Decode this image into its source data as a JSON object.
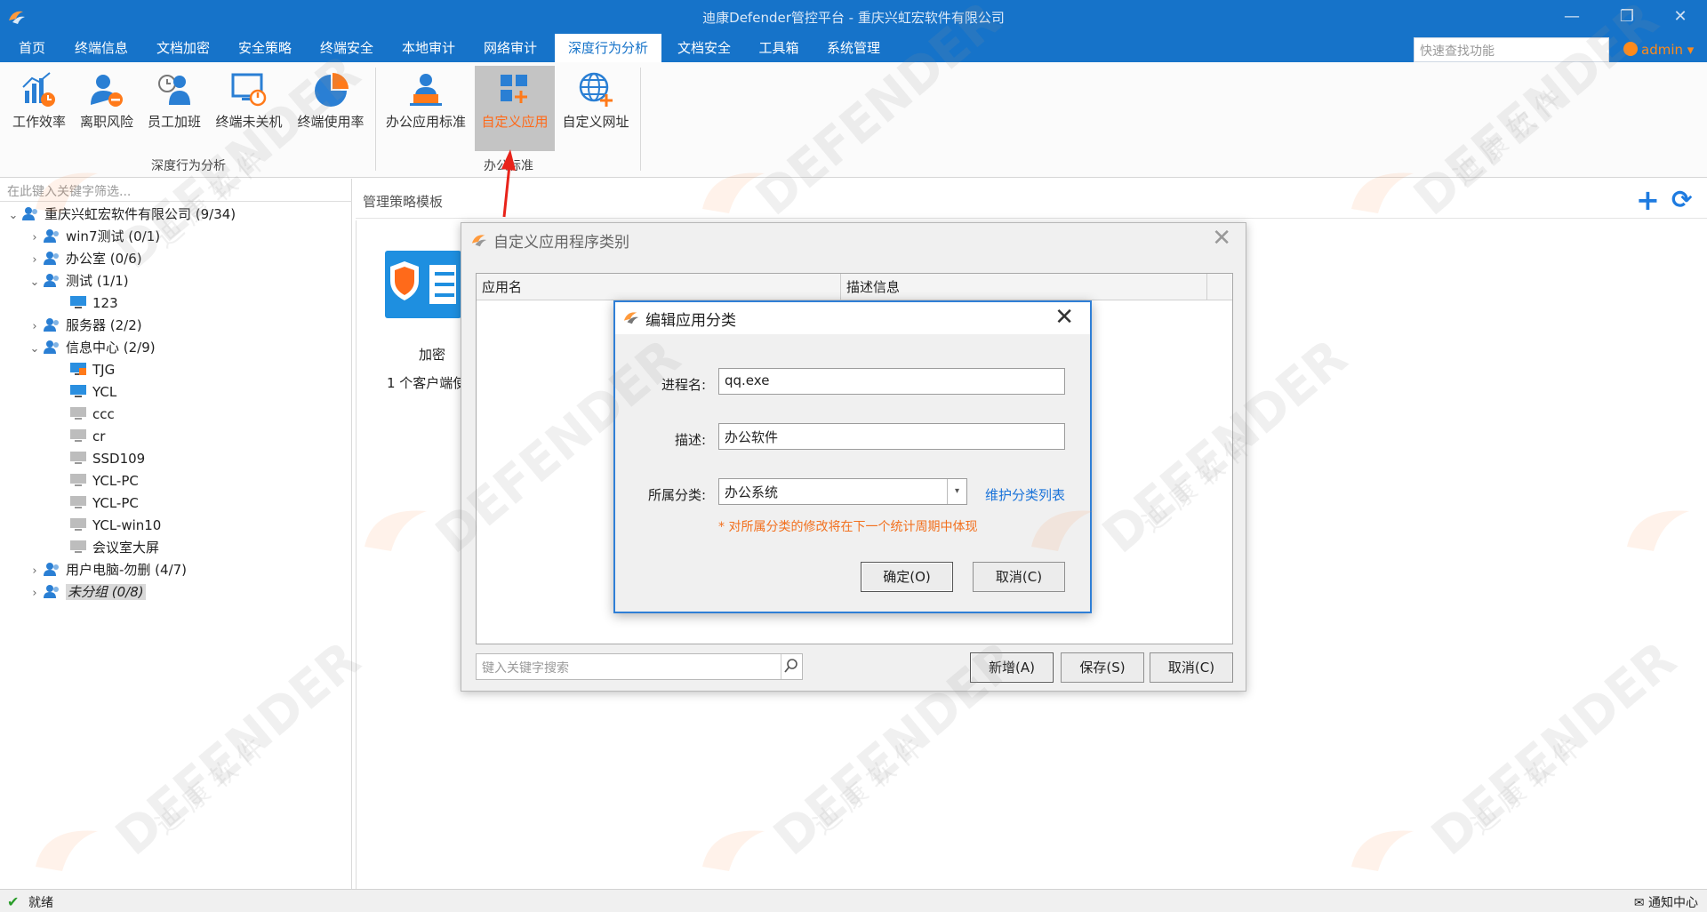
{
  "window": {
    "title": "迪康Defender管控平台 - 重庆兴虹宏软件有限公司",
    "min": "—",
    "restore": "❐",
    "close": "✕"
  },
  "menu": [
    {
      "label": "首页"
    },
    {
      "label": "终端信息"
    },
    {
      "label": "文档加密"
    },
    {
      "label": "安全策略"
    },
    {
      "label": "终端安全"
    },
    {
      "label": "本地审计"
    },
    {
      "label": "网络审计"
    },
    {
      "label": "深度行为分析"
    },
    {
      "label": "文档安全"
    },
    {
      "label": "工具箱"
    },
    {
      "label": "系统管理"
    }
  ],
  "quick_search": {
    "placeholder": "快速查找功能"
  },
  "user": {
    "name": "admin ▾"
  },
  "ribbon": {
    "buttons": [
      {
        "label": "工作效率"
      },
      {
        "label": "离职风险"
      },
      {
        "label": "员工加班"
      },
      {
        "label": "终端未关机"
      },
      {
        "label": "终端使用率"
      },
      {
        "label": "办公应用标准"
      },
      {
        "label": "自定义应用"
      },
      {
        "label": "自定义网址"
      }
    ],
    "groups": [
      {
        "label": "深度行为分析"
      },
      {
        "label": "办公标准"
      }
    ]
  },
  "left": {
    "filter_placeholder": "在此键入关键字筛选...",
    "tree": [
      {
        "label": "重庆兴虹宏软件有限公司 (9/34)",
        "arrow": "⌄"
      },
      {
        "label": "win7测试 (0/1)",
        "arrow": "›"
      },
      {
        "label": "办公室 (0/6)",
        "arrow": "›"
      },
      {
        "label": "测试 (1/1)",
        "arrow": "⌄"
      },
      {
        "label": "123",
        "arrow": ""
      },
      {
        "label": "服务器 (2/2)",
        "arrow": "›"
      },
      {
        "label": "信息中心 (2/9)",
        "arrow": "⌄"
      },
      {
        "label": "TJG",
        "arrow": ""
      },
      {
        "label": "YCL",
        "arrow": ""
      },
      {
        "label": "ccc",
        "arrow": ""
      },
      {
        "label": "cr",
        "arrow": ""
      },
      {
        "label": "SSD109",
        "arrow": ""
      },
      {
        "label": "YCL-PC",
        "arrow": ""
      },
      {
        "label": "YCL-PC",
        "arrow": ""
      },
      {
        "label": "YCL-win10",
        "arrow": ""
      },
      {
        "label": "会议室大屏",
        "arrow": ""
      },
      {
        "label": "用户电脑-勿删 (4/7)",
        "arrow": "›"
      },
      {
        "label": "未分组 (0/8)",
        "arrow": "›"
      }
    ]
  },
  "main": {
    "header": "管理策略模板",
    "add": "+",
    "refresh": "⟳",
    "card_title": "加密",
    "card_sub": "1 个客户端使"
  },
  "dialog_apps": {
    "title": "自定义应用程序类别",
    "close": "✕",
    "columns": [
      "应用名",
      "描述信息"
    ],
    "search_placeholder": "键入关键字搜索",
    "buttons": {
      "add": "新增(A)",
      "save": "保存(S)",
      "cancel": "取消(C)"
    }
  },
  "dialog_edit": {
    "title": "编辑应用分类",
    "close": "✕",
    "process_label": "进程名:",
    "process_value": "qq.exe",
    "desc_label": "描述:",
    "desc_value": "办公软件",
    "cat_label": "所属分类:",
    "cat_value": "办公系统",
    "dd": "▾",
    "maintain_link": "维护分类列表",
    "note": "* 对所属分类的修改将在下一个统计周期中体现",
    "ok": "确定(O)",
    "cancel": "取消(C)"
  },
  "status": {
    "ok_icon": "✔",
    "text": "就绪",
    "notice": "✉ 通知中心"
  },
  "watermark": {
    "brand": "DEFENDER",
    "cn": "迪 康 软 件"
  },
  "colors": {
    "titlebar": "#1673c9",
    "accent_orange": "#ff6a1a",
    "link": "#1a73d9"
  }
}
